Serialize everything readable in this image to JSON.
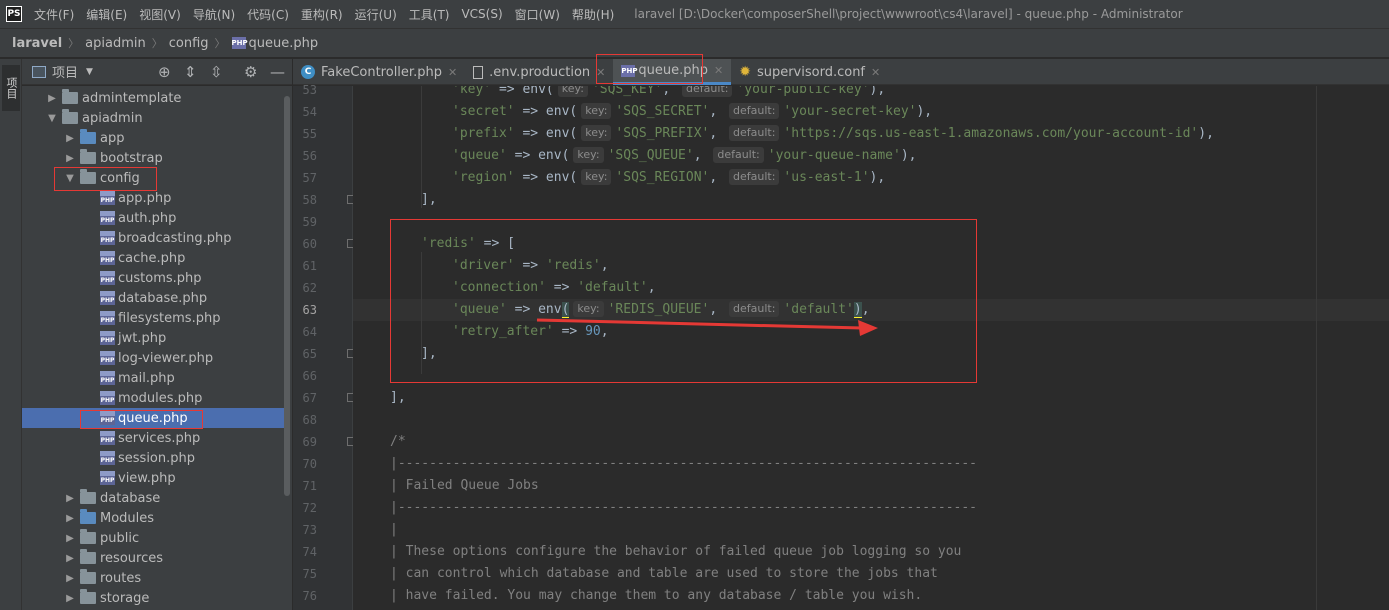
{
  "menubar": {
    "logo": "PS",
    "items": [
      "文件(F)",
      "编辑(E)",
      "视图(V)",
      "导航(N)",
      "代码(C)",
      "重构(R)",
      "运行(U)",
      "工具(T)",
      "VCS(S)",
      "窗口(W)",
      "帮助(H)"
    ],
    "window_title": "laravel [D:\\Docker\\composerShell\\project\\wwwroot\\cs4\\laravel] - queue.php - Administrator"
  },
  "breadcrumb": {
    "items": [
      "laravel",
      "apiadmin",
      "config",
      "queue.php"
    ]
  },
  "toolstrip": {
    "label": "项目"
  },
  "project": {
    "title": "项目",
    "tree": [
      {
        "label": "admintemplate",
        "type": "folder",
        "expanded": false
      },
      {
        "label": "apiadmin",
        "type": "folder",
        "expanded": true
      },
      {
        "label": "app",
        "type": "folder-src",
        "expanded": false
      },
      {
        "label": "bootstrap",
        "type": "folder",
        "expanded": false
      },
      {
        "label": "config",
        "type": "folder",
        "expanded": true
      },
      {
        "label": "app.php",
        "type": "php"
      },
      {
        "label": "auth.php",
        "type": "php"
      },
      {
        "label": "broadcasting.php",
        "type": "php"
      },
      {
        "label": "cache.php",
        "type": "php"
      },
      {
        "label": "customs.php",
        "type": "php"
      },
      {
        "label": "database.php",
        "type": "php"
      },
      {
        "label": "filesystems.php",
        "type": "php"
      },
      {
        "label": "jwt.php",
        "type": "php"
      },
      {
        "label": "log-viewer.php",
        "type": "php"
      },
      {
        "label": "mail.php",
        "type": "php"
      },
      {
        "label": "modules.php",
        "type": "php"
      },
      {
        "label": "queue.php",
        "type": "php",
        "selected": true
      },
      {
        "label": "services.php",
        "type": "php"
      },
      {
        "label": "session.php",
        "type": "php"
      },
      {
        "label": "view.php",
        "type": "php"
      },
      {
        "label": "database",
        "type": "folder",
        "expanded": false
      },
      {
        "label": "Modules",
        "type": "folder",
        "expanded": false
      },
      {
        "label": "public",
        "type": "folder",
        "expanded": false
      },
      {
        "label": "resources",
        "type": "folder",
        "expanded": false
      },
      {
        "label": "routes",
        "type": "folder",
        "expanded": false
      },
      {
        "label": "storage",
        "type": "folder",
        "expanded": false
      }
    ]
  },
  "tabs": [
    {
      "label": "FakeController.php",
      "icon": "class-icon",
      "active": false
    },
    {
      "label": ".env.production",
      "icon": "text-file-icon",
      "active": false
    },
    {
      "label": "queue.php",
      "icon": "php-file-icon",
      "active": true
    },
    {
      "label": "supervisord.conf",
      "icon": "config-gear-icon",
      "active": false
    }
  ],
  "editor": {
    "current_line": 63,
    "line_numbers": [
      "53",
      "54",
      "55",
      "56",
      "57",
      "58",
      "59",
      "60",
      "61",
      "62",
      "63",
      "64",
      "65",
      "66",
      "67",
      "68",
      "69",
      "70",
      "71",
      "72",
      "73",
      "74",
      "75",
      "76"
    ],
    "hint_key": "key:",
    "hint_default": "default:",
    "lines": {
      "l53": {
        "k": "'key'",
        "envkey": "'SQS_KEY'",
        "def": "'your-public-key'"
      },
      "l54": {
        "k": "'secret'",
        "envkey": "'SQS_SECRET'",
        "def": "'your-secret-key'"
      },
      "l55": {
        "k": "'prefix'",
        "envkey": "'SQS_PREFIX'",
        "def": "'https://sqs.us-east-1.amazonaws.com/your-account-id'"
      },
      "l56": {
        "k": "'queue'",
        "envkey": "'SQS_QUEUE'",
        "def": "'your-queue-name'"
      },
      "l57": {
        "k": "'region'",
        "envkey": "'SQS_REGION'",
        "def": "'us-east-1'"
      },
      "l58": "],",
      "l60_key": "'redis'",
      "l60_rest": " => [",
      "l61_key": "'driver'",
      "l61_val": "'redis'",
      "l62_key": "'connection'",
      "l62_val": "'default'",
      "l63": {
        "k": "'queue'",
        "envkey": "'REDIS_QUEUE'",
        "def": "'default'"
      },
      "l64_key": "'retry_after'",
      "l64_val": "90",
      "l65": "],",
      "l67": "],",
      "l69": "/*",
      "l70": "|--------------------------------------------------------------------------",
      "l71": "| Failed Queue Jobs",
      "l72": "|--------------------------------------------------------------------------",
      "l73": "|",
      "l74": "| These options configure the behavior of failed queue job logging so you",
      "l75": "| can control which database and table are used to store the jobs that",
      "l76": "| have failed. You may change them to any database / table you wish."
    }
  },
  "colors": {
    "annotation": "#e53935",
    "selection": "#4b6eaf",
    "string": "#6a8759",
    "number": "#6897bb",
    "comment": "#808080"
  }
}
